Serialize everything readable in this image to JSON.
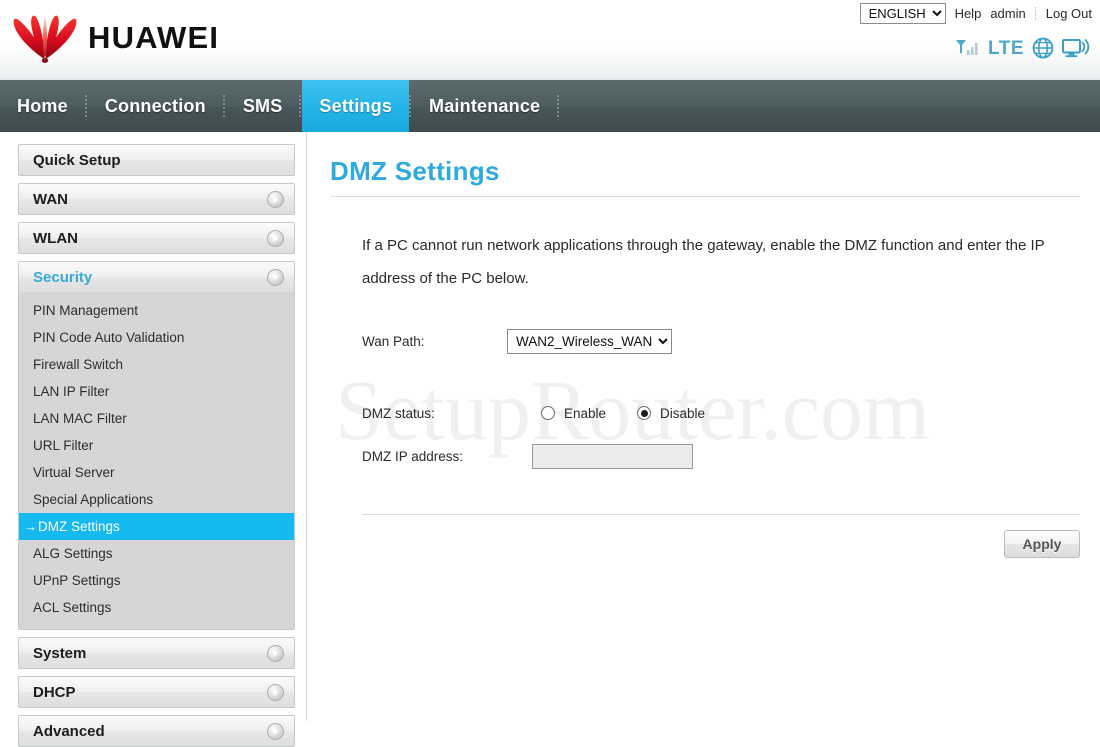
{
  "brand": {
    "name": "HUAWEI",
    "logo_color": "#cf0a2c"
  },
  "header": {
    "language": "ENGLISH",
    "language_options": [
      "ENGLISH"
    ],
    "help_label": "Help",
    "user_label": "admin",
    "logout_label": "Log Out",
    "status": {
      "signal_icon": "signal-bars-icon",
      "network_type": "LTE",
      "globe_icon": "globe-icon",
      "device_icon": "monitor-wifi-icon",
      "accent_color": "#4fa8c9"
    }
  },
  "nav": {
    "active": "Settings",
    "items": [
      {
        "label": "Home"
      },
      {
        "label": "Connection"
      },
      {
        "label": "SMS"
      },
      {
        "label": "Settings"
      },
      {
        "label": "Maintenance"
      }
    ]
  },
  "sidebar": {
    "groups": [
      {
        "label": "Quick Setup",
        "state": "plain",
        "icon": "",
        "items": []
      },
      {
        "label": "WAN",
        "state": "collapsed",
        "icon": "chevron-right-icon",
        "items": []
      },
      {
        "label": "WLAN",
        "state": "collapsed",
        "icon": "chevron-right-icon",
        "items": []
      },
      {
        "label": "Security",
        "state": "expanded",
        "icon": "chevron-down-icon",
        "items": [
          {
            "label": "PIN Management",
            "selected": false
          },
          {
            "label": "PIN Code Auto Validation",
            "selected": false
          },
          {
            "label": "Firewall Switch",
            "selected": false
          },
          {
            "label": "LAN IP Filter",
            "selected": false
          },
          {
            "label": "LAN MAC Filter",
            "selected": false
          },
          {
            "label": "URL Filter",
            "selected": false
          },
          {
            "label": "Virtual Server",
            "selected": false
          },
          {
            "label": "Special Applications",
            "selected": false
          },
          {
            "label": "DMZ Settings",
            "selected": true
          },
          {
            "label": "ALG Settings",
            "selected": false
          },
          {
            "label": "UPnP Settings",
            "selected": false
          },
          {
            "label": "ACL Settings",
            "selected": false
          }
        ]
      },
      {
        "label": "System",
        "state": "collapsed",
        "icon": "chevron-right-icon",
        "items": []
      },
      {
        "label": "DHCP",
        "state": "collapsed",
        "icon": "chevron-right-icon",
        "items": []
      },
      {
        "label": "Advanced",
        "state": "collapsed",
        "icon": "chevron-right-icon",
        "items": []
      }
    ]
  },
  "main": {
    "title": "DMZ Settings",
    "title_color": "#2eaadc",
    "description": "If a PC cannot run network applications through the gateway, enable the DMZ function and enter the IP address of the PC below.",
    "watermark": "SetupRouter.com",
    "fields": {
      "wan_path_label": "Wan Path:",
      "wan_path_value": "WAN2_Wireless_WAN",
      "wan_path_options": [
        "WAN2_Wireless_WAN"
      ],
      "dmz_status_label": "DMZ status:",
      "dmz_enable_label": "Enable",
      "dmz_disable_label": "Disable",
      "dmz_status_selected": "Disable",
      "dmz_ip_label": "DMZ IP address:",
      "dmz_ip_value": "",
      "dmz_ip_placeholder": ""
    },
    "apply_label": "Apply"
  }
}
